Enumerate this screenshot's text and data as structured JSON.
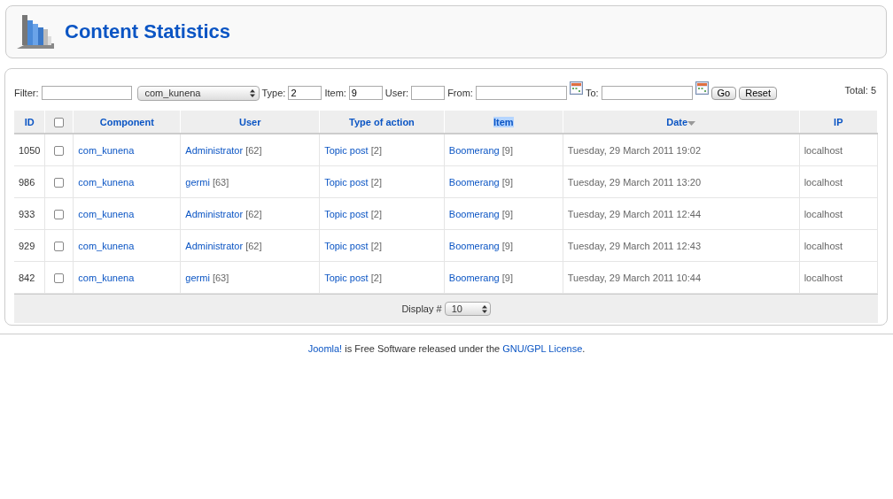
{
  "header": {
    "title": "Content Statistics"
  },
  "filters": {
    "filter_label": "Filter:",
    "component_value": "com_kunena",
    "type_label": "Type:",
    "type_value": "2",
    "item_label": "Item:",
    "item_value": "9",
    "user_label": "User:",
    "from_label": "From:",
    "to_label": "To:",
    "go": "Go",
    "reset": "Reset",
    "total": "Total: 5"
  },
  "table": {
    "columns": [
      {
        "kind": "text",
        "label": "ID",
        "selected": false,
        "sorted": false
      },
      {
        "kind": "checkbox",
        "checked": false
      },
      {
        "kind": "text",
        "label": "Component",
        "selected": false,
        "sorted": false
      },
      {
        "kind": "text",
        "label": "User",
        "selected": false,
        "sorted": false
      },
      {
        "kind": "text",
        "label": "Type of action",
        "selected": false,
        "sorted": false
      },
      {
        "kind": "text",
        "label": "Item",
        "selected": true,
        "sorted": false
      },
      {
        "kind": "text",
        "label": "Date",
        "selected": false,
        "sorted": true
      },
      {
        "kind": "text",
        "label": "IP",
        "selected": false,
        "sorted": false
      }
    ],
    "rows": [
      {
        "id": "1050",
        "checked": false,
        "component": "com_kunena",
        "user": "Administrator",
        "user_id": "[62]",
        "action": "Topic post",
        "action_id": "[2]",
        "item": "Boomerang",
        "item_id": "[9]",
        "date": "Tuesday, 29 March 2011 19:02",
        "ip": "localhost"
      },
      {
        "id": "986",
        "checked": false,
        "component": "com_kunena",
        "user": "germi",
        "user_id": "[63]",
        "action": "Topic post",
        "action_id": "[2]",
        "item": "Boomerang",
        "item_id": "[9]",
        "date": "Tuesday, 29 March 2011 13:20",
        "ip": "localhost"
      },
      {
        "id": "933",
        "checked": false,
        "component": "com_kunena",
        "user": "Administrator",
        "user_id": "[62]",
        "action": "Topic post",
        "action_id": "[2]",
        "item": "Boomerang",
        "item_id": "[9]",
        "date": "Tuesday, 29 March 2011 12:44",
        "ip": "localhost"
      },
      {
        "id": "929",
        "checked": false,
        "component": "com_kunena",
        "user": "Administrator",
        "user_id": "[62]",
        "action": "Topic post",
        "action_id": "[2]",
        "item": "Boomerang",
        "item_id": "[9]",
        "date": "Tuesday, 29 March 2011 12:43",
        "ip": "localhost"
      },
      {
        "id": "842",
        "checked": false,
        "component": "com_kunena",
        "user": "germi",
        "user_id": "[63]",
        "action": "Topic post",
        "action_id": "[2]",
        "item": "Boomerang",
        "item_id": "[9]",
        "date": "Tuesday, 29 March 2011 10:44",
        "ip": "localhost"
      }
    ],
    "display_label": "Display #",
    "display_value": "10"
  },
  "footer": {
    "link1": "Joomla!",
    "text": "is Free Software released under the",
    "link2": "GNU/GPL License",
    "end": "."
  }
}
